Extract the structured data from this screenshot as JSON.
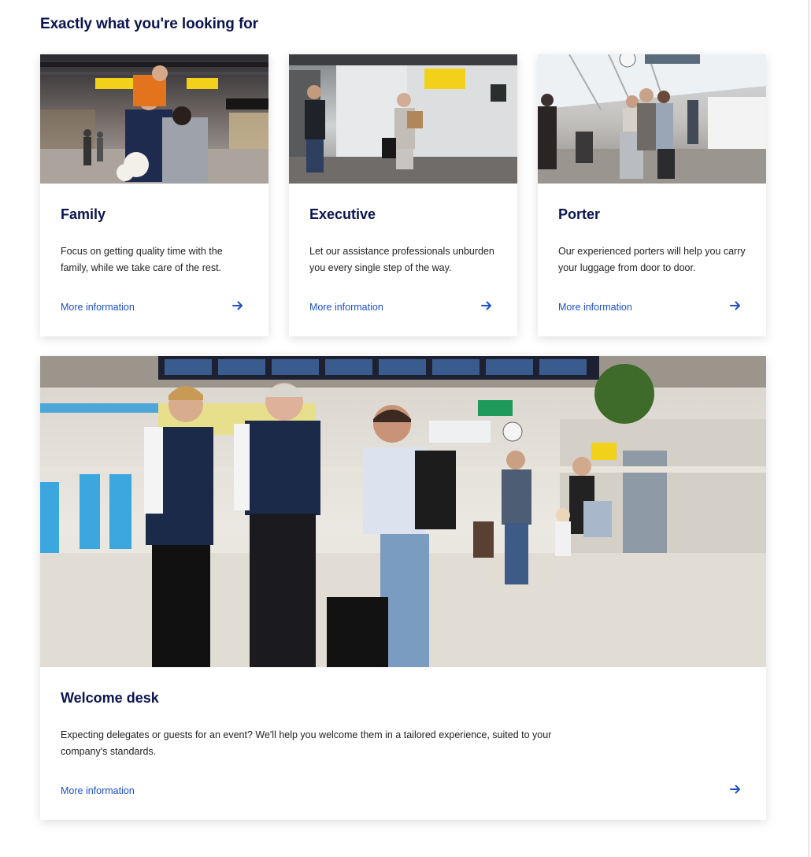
{
  "section": {
    "title": "Exactly what you're looking for"
  },
  "cards": [
    {
      "title": "Family",
      "description": "Focus on getting quality time with the family, while we take care of the rest.",
      "link_label": "More information",
      "image_alt": "Family with child on shoulders and small dog in airport terminal"
    },
    {
      "title": "Executive",
      "description": "Let our assistance professionals unburden you every single step of the way.",
      "link_label": "More information",
      "image_alt": "Business traveller walking with suitcase in terminal"
    },
    {
      "title": "Porter",
      "description": "Our experienced porters will help you carry your luggage from door to door.",
      "link_label": "More information",
      "image_alt": "Porter with luggage trolley and travellers in departure hall"
    },
    {
      "title": "Welcome desk",
      "description": "Expecting delegates or guests for an event? We'll help you welcome them in a tailored experience, suited to your company's standards.",
      "link_label": "More information",
      "image_alt": "Two assistance staff welcoming a traveller in the airport plaza"
    }
  ],
  "icons": {
    "arrow": "arrow-right-icon"
  },
  "colors": {
    "heading": "#0a1450",
    "link": "#1c4fc4",
    "text": "#222222"
  }
}
